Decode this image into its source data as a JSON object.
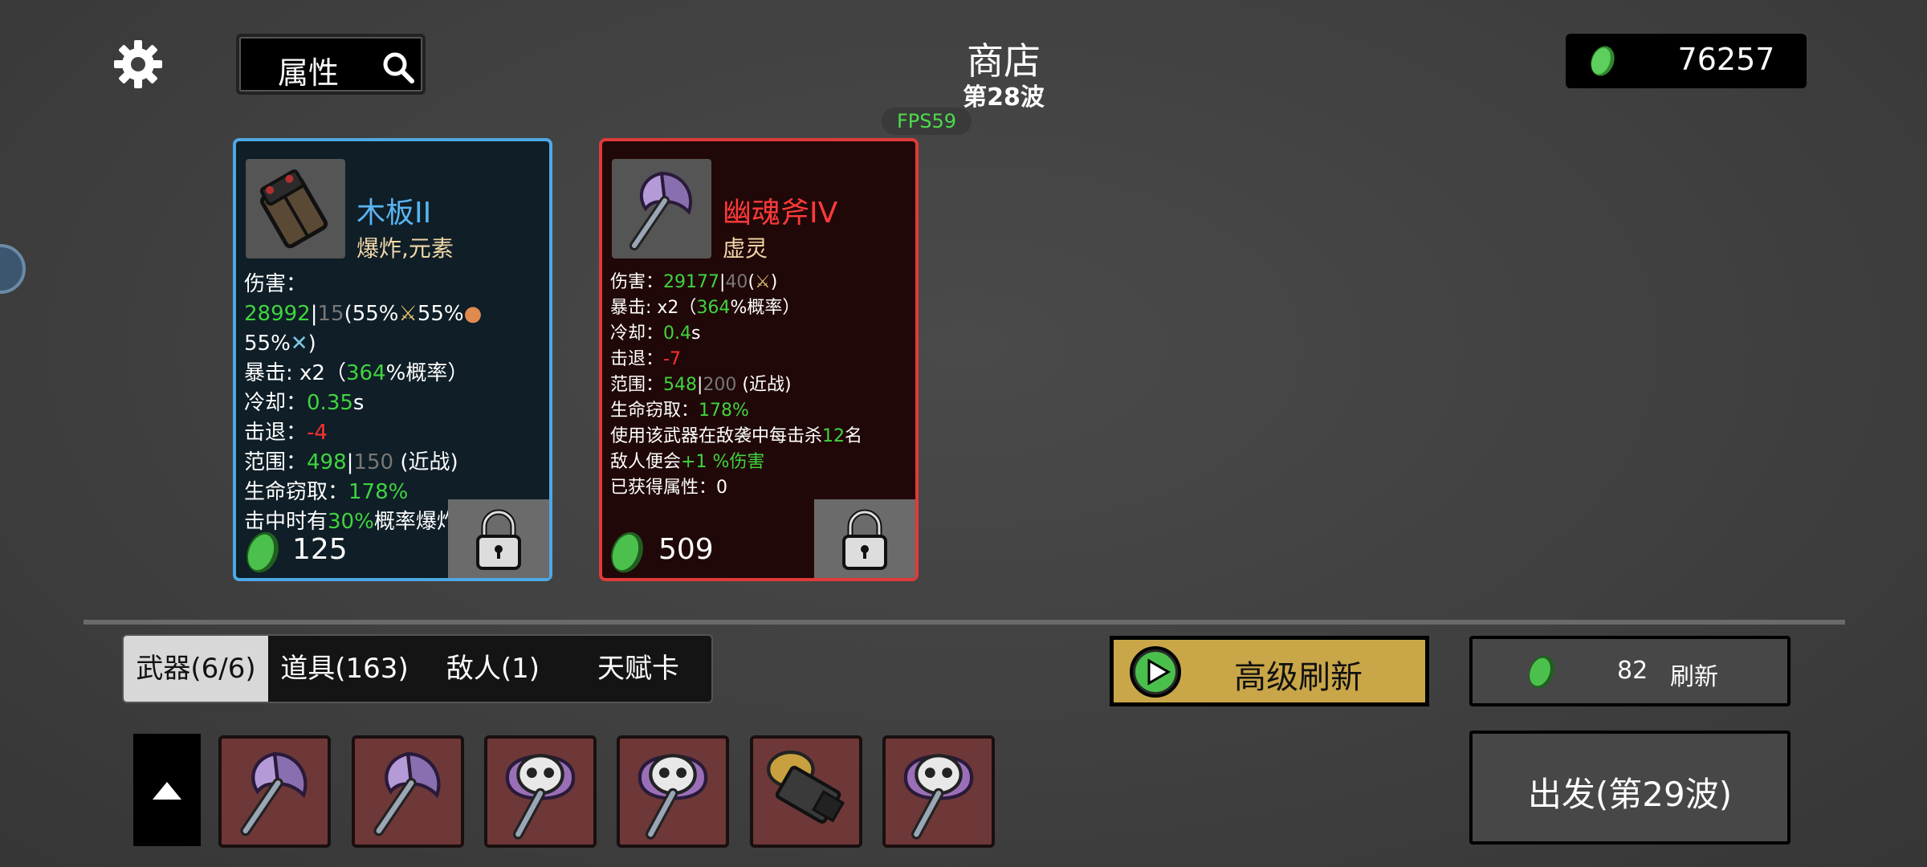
{
  "header": {
    "search_label": "属性",
    "title": "商店",
    "wave": "第28波",
    "fps": "FPS59",
    "money": "76257"
  },
  "cards": [
    {
      "name": "木板II",
      "tags": "爆炸,元素",
      "price": "125",
      "name_color": "#5ab4f0",
      "lines": {
        "dmg_label": "伤害：",
        "dmg_val": "28992",
        "dmg_sep": "|",
        "dmg_base": "15",
        "dmg_scale_1": "(55%",
        "dmg_scale_2": "55%",
        "dmg_scale_3": "55%",
        "dmg_close": ")",
        "crit_label": "暴击:  x2（",
        "crit_val": "364",
        "crit_suffix": "%概率）",
        "cd_label": "冷却：",
        "cd_val": "0.35",
        "cd_unit": "s",
        "kb_label": "击退：",
        "kb_val": "-4",
        "range_label": "范围：",
        "range_val": "498",
        "range_sep": "|",
        "range_base": "150",
        "range_type": " (近战)",
        "ls_label": "生命窃取：",
        "ls_val": "178%",
        "proc_pre": "击中时有",
        "proc_val": "30%",
        "proc_post": "概率爆炸"
      }
    },
    {
      "name": "幽魂斧IV",
      "tags": "虚灵",
      "price": "509",
      "name_color": "#ff3a3a",
      "lines": {
        "dmg_label": "伤害：",
        "dmg_val": "29177",
        "dmg_sep": "|",
        "dmg_base": "40",
        "dmg_scale": "(",
        "dmg_close": ")",
        "crit_label": "暴击:  x2（",
        "crit_val": "364",
        "crit_suffix": "%概率）",
        "cd_label": "冷却：",
        "cd_val": "0.4",
        "cd_unit": "s",
        "kb_label": "击退：",
        "kb_val": "-7",
        "range_label": "范围：",
        "range_val": "548",
        "range_sep": "|",
        "range_base": "200",
        "range_type": " (近战)",
        "ls_label": "生命窃取：",
        "ls_val": "178%",
        "desc1_pre": "使用该武器在敌袭中每击杀",
        "desc1_val": "12",
        "desc1_post": "名",
        "desc2_pre": "敌人便会",
        "desc2_val": "+1 %伤害",
        "gained_label": "已获得属性：",
        "gained_val": "0"
      }
    }
  ],
  "tabs": [
    {
      "label": "武器(6/6)",
      "active": true
    },
    {
      "label": "道具(163)",
      "active": false
    },
    {
      "label": "敌人(1)",
      "active": false
    },
    {
      "label": "天赋卡",
      "active": false
    }
  ],
  "buttons": {
    "advanced_refresh": "高级刷新",
    "refresh_cost": "82",
    "refresh": "刷新",
    "depart": "出发(第29波)"
  },
  "inventory": [
    "ghost-axe-icon",
    "ghost-axe-icon",
    "skull-axe-icon",
    "skull-axe-icon",
    "plank-bomb-icon",
    "skull-axe-icon"
  ],
  "colors": {
    "blue_border": "#4ea8e4",
    "red_border": "#e03a3a",
    "green_value": "#3fd43f",
    "red_value": "#ff3030",
    "gold_button": "#c9a648",
    "slot_bg": "#6e3838"
  }
}
